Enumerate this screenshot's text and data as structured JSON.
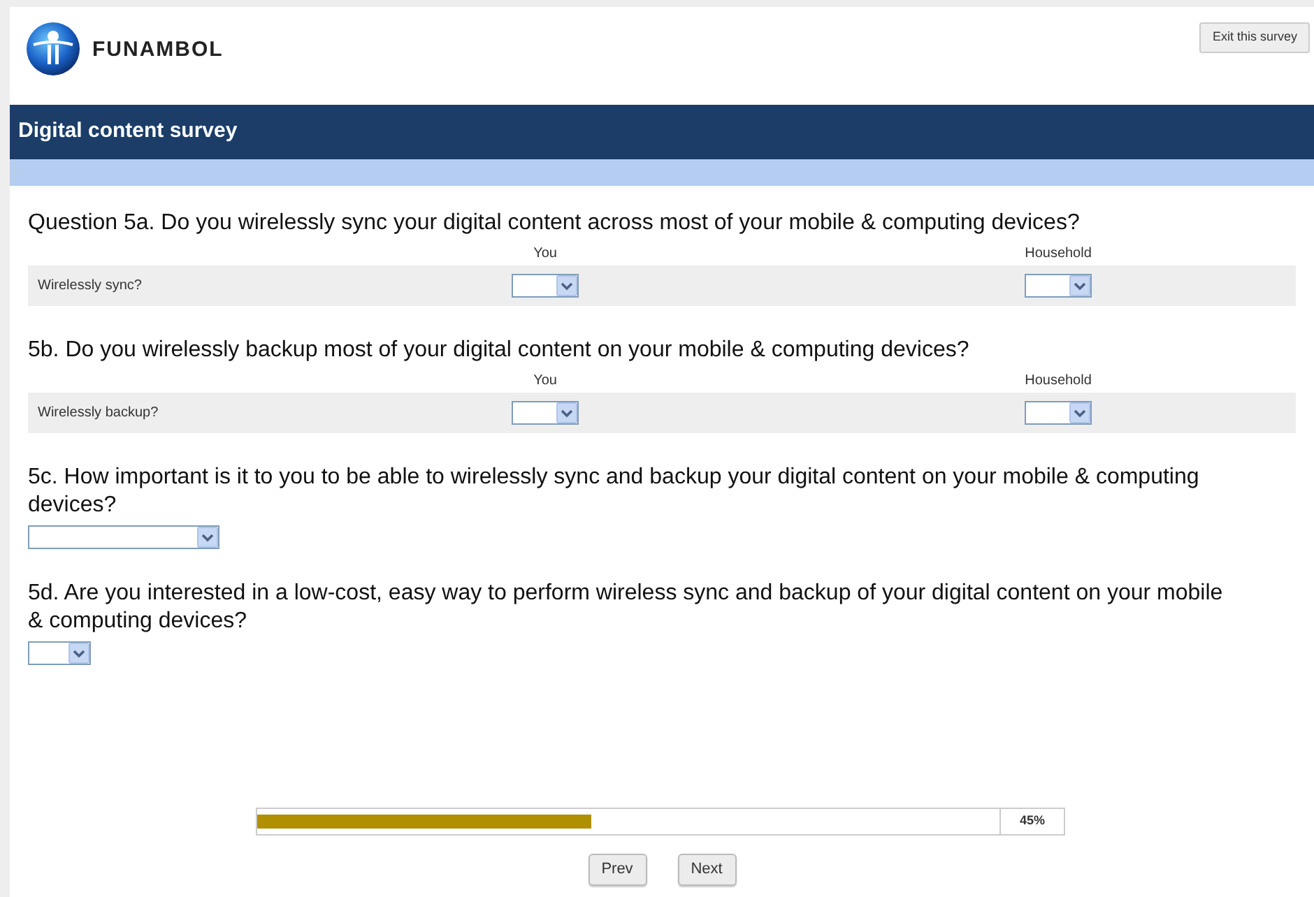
{
  "header": {
    "logo_text": "FUNAMBOL",
    "exit_button": "Exit this survey"
  },
  "title_bar": {
    "title": "Digital content survey"
  },
  "questions": [
    {
      "kind": "matrix",
      "text": "Question 5a. Do you wirelessly sync your digital content across most of your mobile & computing devices?",
      "columns": [
        "You",
        "Household"
      ],
      "rows": [
        {
          "label": "Wirelessly sync?"
        }
      ]
    },
    {
      "kind": "matrix",
      "text": "5b. Do you wirelessly backup most of your digital content on your mobile & computing devices?",
      "columns": [
        "You",
        "Household"
      ],
      "rows": [
        {
          "label": "Wirelessly backup?"
        }
      ]
    },
    {
      "kind": "longselect",
      "text": "5c. How important is it to you to be able to wirelessly sync and backup your digital content on your mobile & computing devices?"
    },
    {
      "kind": "shortselect",
      "text": "5d. Are you interested in a low-cost, easy way to perform wireless sync and backup of your digital content on your mobile & computing devices?"
    }
  ],
  "progress": {
    "level": 0.45,
    "reading": "45%"
  },
  "buttons": [
    "Prev",
    "Next"
  ]
}
